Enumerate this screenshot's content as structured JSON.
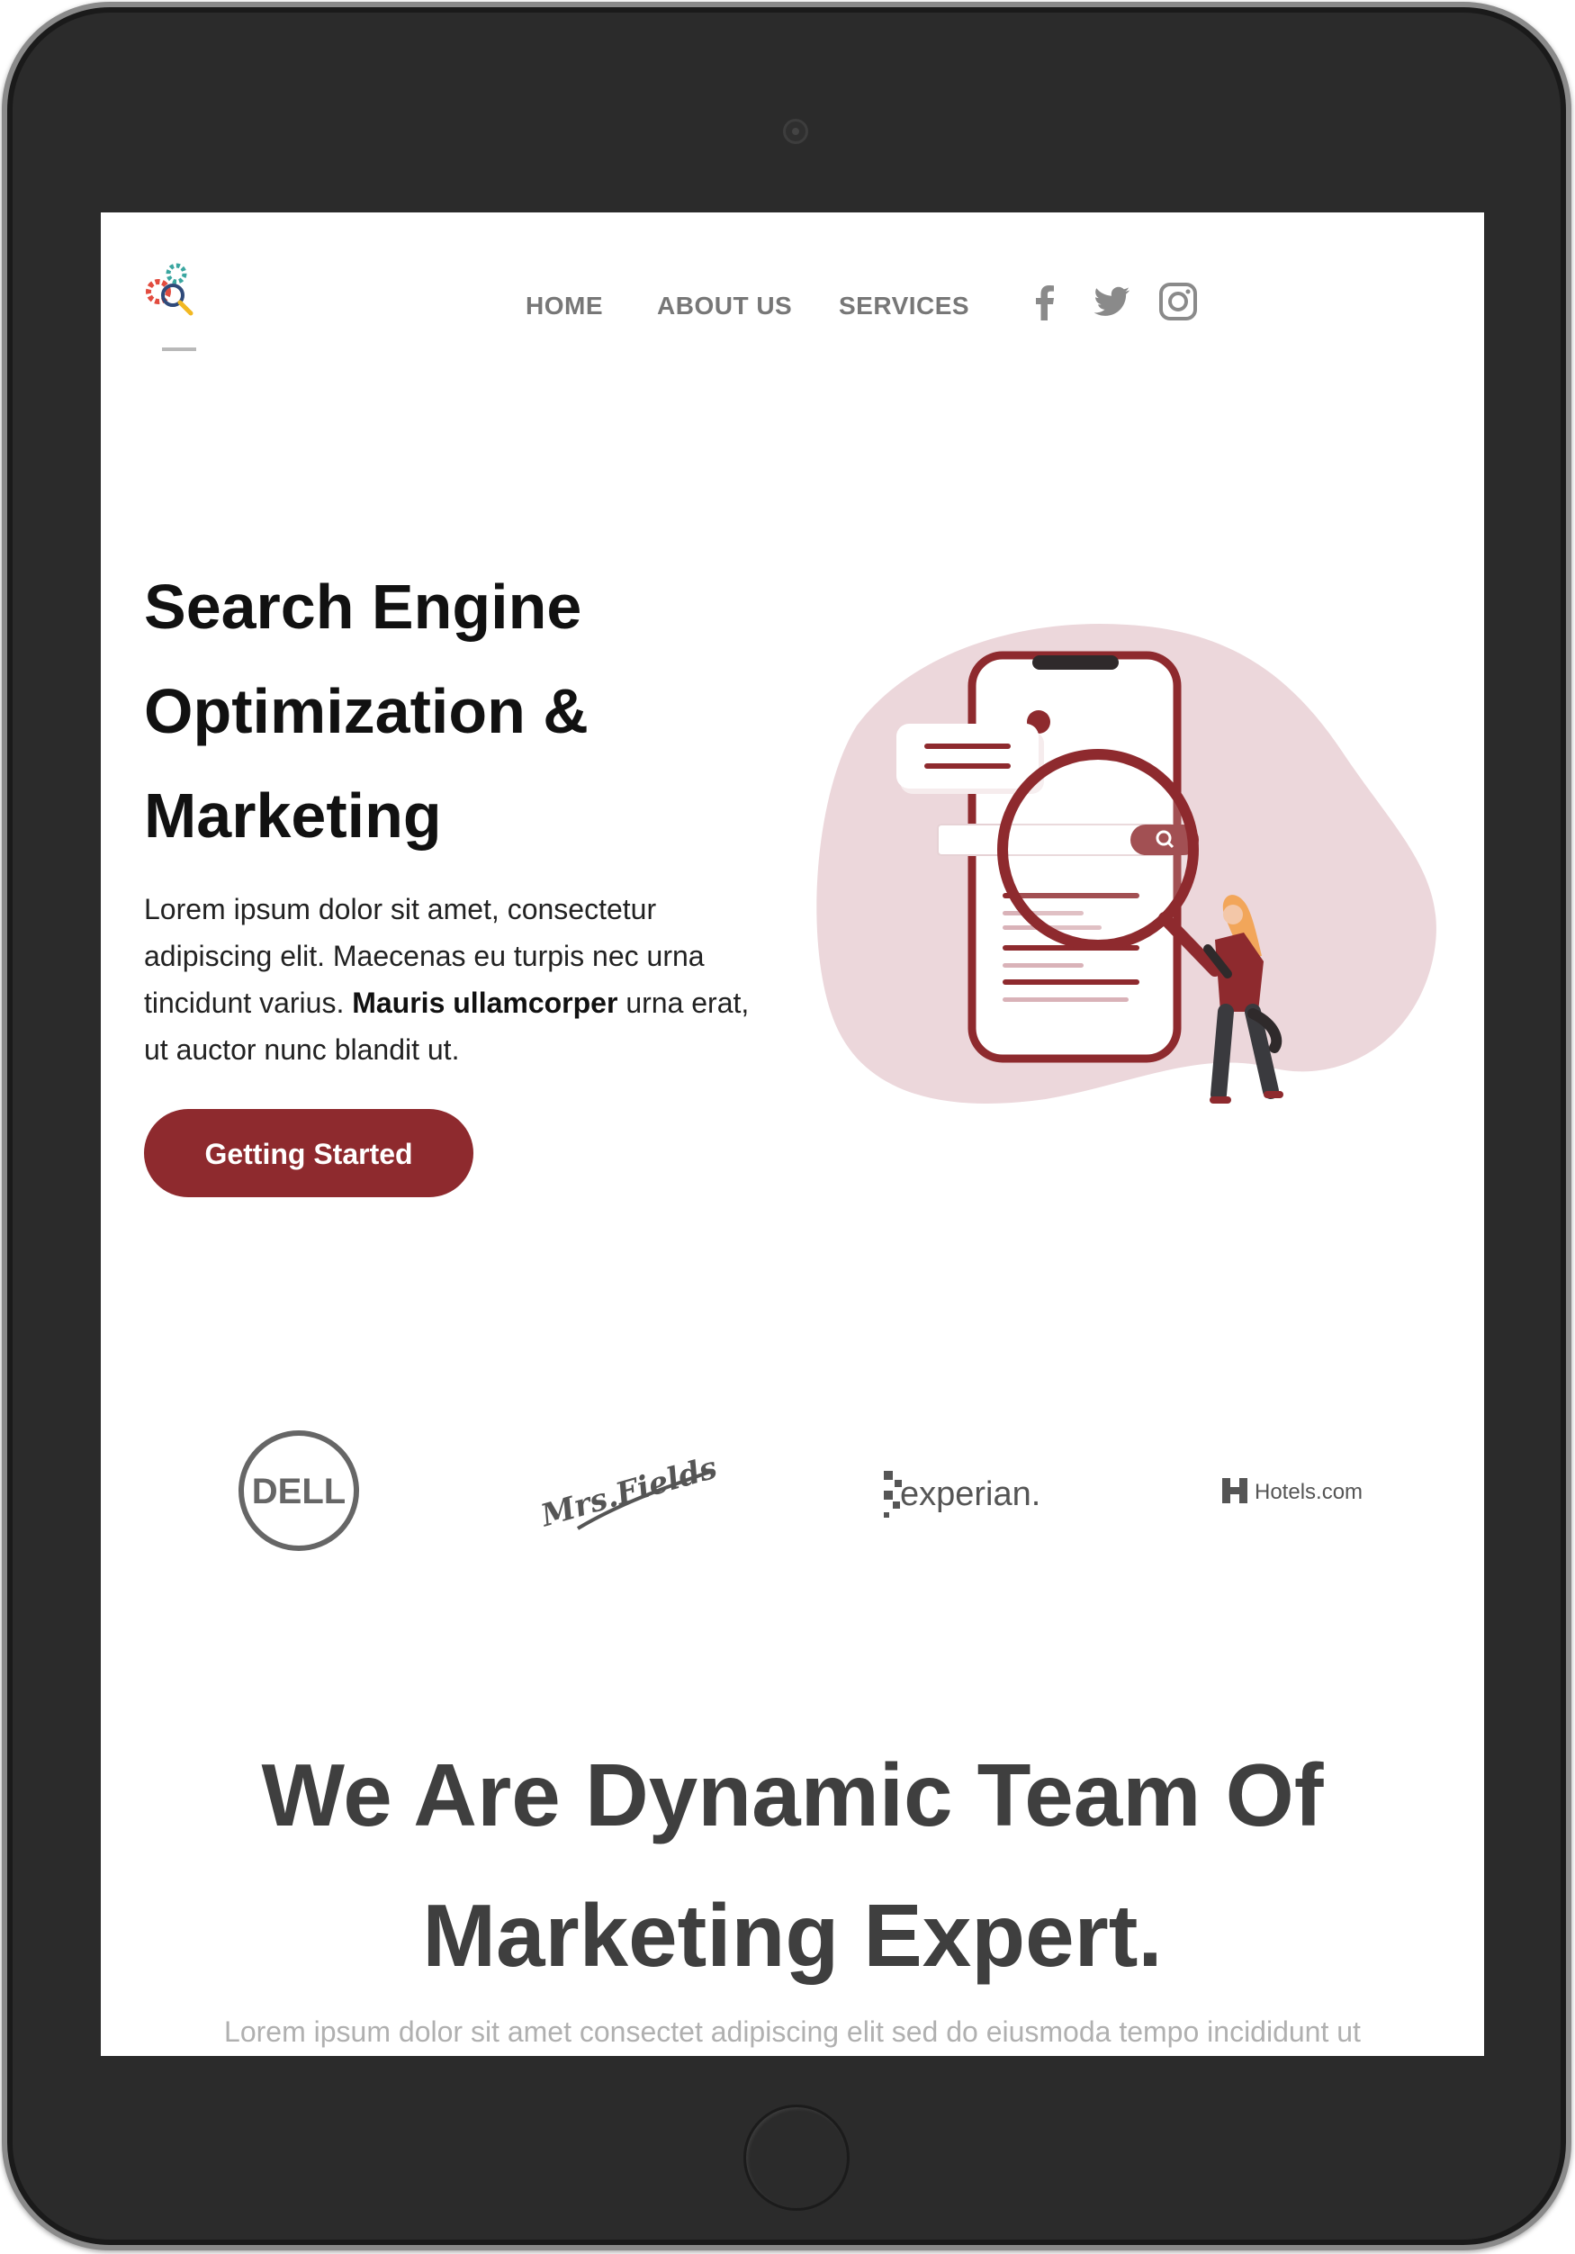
{
  "nav": {
    "items": [
      "HOME",
      "ABOUT US",
      "SERVICES"
    ]
  },
  "social": {
    "icons": [
      "facebook-icon",
      "twitter-icon",
      "instagram-icon"
    ]
  },
  "hero": {
    "title_lines": [
      "Search Engine",
      "Optimization &",
      "Marketing"
    ],
    "text_before_bold": "Lorem ipsum dolor sit amet, consectetur adipiscing elit. Maecenas eu turpis nec urna tincidunt varius. ",
    "text_bold": "Mauris ullamcorper",
    "text_after_bold": " urna erat, ut auctor nunc blandit ut.",
    "cta_label": "Getting Started"
  },
  "clients": {
    "logos": [
      "DELL",
      "Mrs.Fields",
      "experian.",
      "Hotels.com"
    ]
  },
  "team": {
    "title_lines": [
      "We Are Dynamic Team Of",
      "Marketing Expert."
    ],
    "subtitle": "Lorem ipsum dolor sit amet consectet adipiscing elit sed do eiusmoda tempo incididunt ut"
  },
  "colors": {
    "brand": "#8e2a2e",
    "blob": "#ecd7db",
    "nav_text": "#777777",
    "frame": "#2b2b2b"
  }
}
